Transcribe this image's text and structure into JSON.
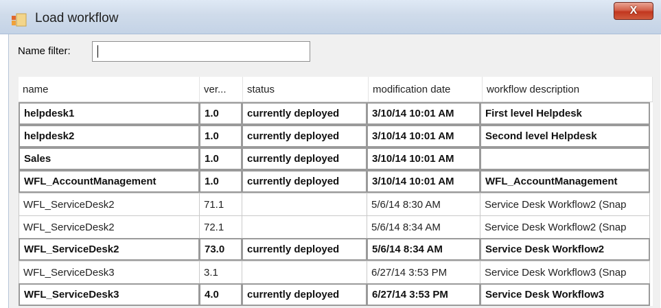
{
  "window": {
    "title": "Load workflow",
    "close_label": "X",
    "icon": "workflow-app-icon"
  },
  "filter": {
    "label": "Name filter:",
    "value": ""
  },
  "columns": [
    "name",
    "ver...",
    "status",
    "modification date",
    "workflow description"
  ],
  "rows": [
    {
      "name": "helpdesk1",
      "version": "1.0",
      "status": "currently deployed",
      "date": "3/10/14 10:01 AM",
      "description": "First level Helpdesk",
      "deployed": true
    },
    {
      "name": "helpdesk2",
      "version": "1.0",
      "status": "currently deployed",
      "date": "3/10/14 10:01 AM",
      "description": "Second level Helpdesk",
      "deployed": true
    },
    {
      "name": "Sales",
      "version": "1.0",
      "status": "currently deployed",
      "date": "3/10/14 10:01 AM",
      "description": "",
      "deployed": true
    },
    {
      "name": "WFL_AccountManagement",
      "version": "1.0",
      "status": "currently deployed",
      "date": "3/10/14 10:01 AM",
      "description": "WFL_AccountManagement",
      "deployed": true
    },
    {
      "name": "WFL_ServiceDesk2",
      "version": "71.1",
      "status": "",
      "date": "5/6/14 8:30 AM",
      "description": "Service Desk Workflow2 (Snap",
      "deployed": false
    },
    {
      "name": "WFL_ServiceDesk2",
      "version": "72.1",
      "status": "",
      "date": "5/6/14 8:34 AM",
      "description": "Service Desk Workflow2 (Snap",
      "deployed": false
    },
    {
      "name": "WFL_ServiceDesk2",
      "version": "73.0",
      "status": "currently deployed",
      "date": "5/6/14 8:34 AM",
      "description": "Service Desk Workflow2",
      "deployed": true
    },
    {
      "name": "WFL_ServiceDesk3",
      "version": "3.1",
      "status": "",
      "date": "6/27/14 3:53 PM",
      "description": "Service Desk Workflow3 (Snap",
      "deployed": false
    },
    {
      "name": "WFL_ServiceDesk3",
      "version": "4.0",
      "status": "currently deployed",
      "date": "6/27/14 3:53 PM",
      "description": "Service Desk Workflow3",
      "deployed": true
    }
  ]
}
